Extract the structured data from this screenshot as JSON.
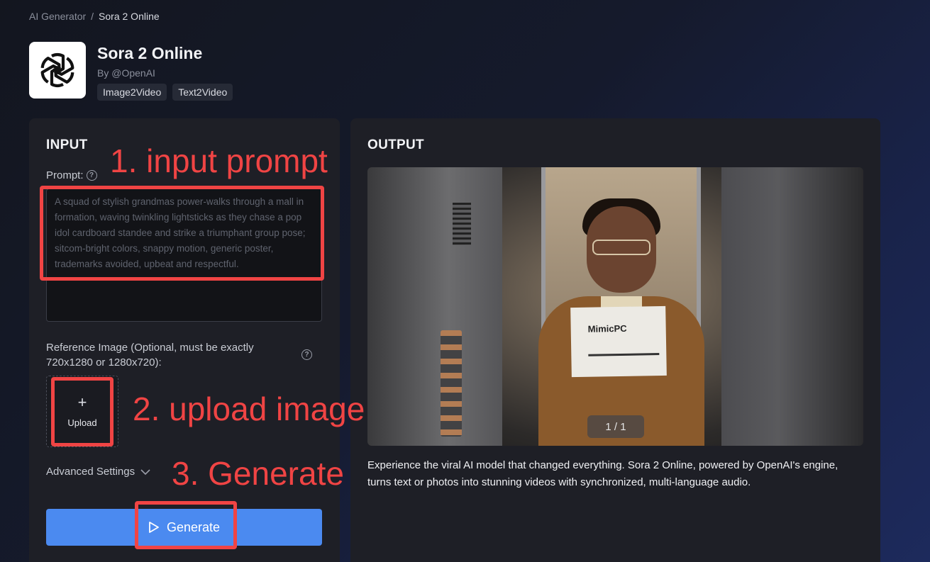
{
  "breadcrumb": {
    "root": "AI Generator",
    "separator": "/",
    "current": "Sora 2 Online"
  },
  "app": {
    "title": "Sora 2 Online",
    "author": "By @OpenAI",
    "logo_icon": "openai-logo-icon",
    "tags": [
      "Image2Video",
      "Text2Video"
    ]
  },
  "input": {
    "title": "INPUT",
    "prompt_label": "Prompt:",
    "prompt_placeholder": "A squad of stylish grandmas power-walks through a mall in formation, waving twinkling lightsticks as they chase a pop idol cardboard standee and strike a triumphant group pose; sitcom-bright colors, snappy motion, generic poster, trademarks avoided, upbeat and respectful.",
    "reference_label": "Reference Image (Optional, must be exactly 720x1280 or 1280x720):",
    "upload_label": "Upload",
    "advanced_label": "Advanced Settings",
    "generate_label": "Generate"
  },
  "output": {
    "title": "OUTPUT",
    "paper_text": "MimicPC",
    "counter": "1 / 1",
    "description": "Experience the viral AI model that changed everything. Sora 2 Online, powered by OpenAI's engine, turns text or photos into stunning videos with synchronized, multi-language audio."
  },
  "annotations": {
    "step1": "1. input prompt",
    "step2": "2. upload image",
    "step3": "3. Generate"
  },
  "colors": {
    "accent": "#4b8af0",
    "annotation": "#f04444",
    "panel": "#1e1f26"
  }
}
